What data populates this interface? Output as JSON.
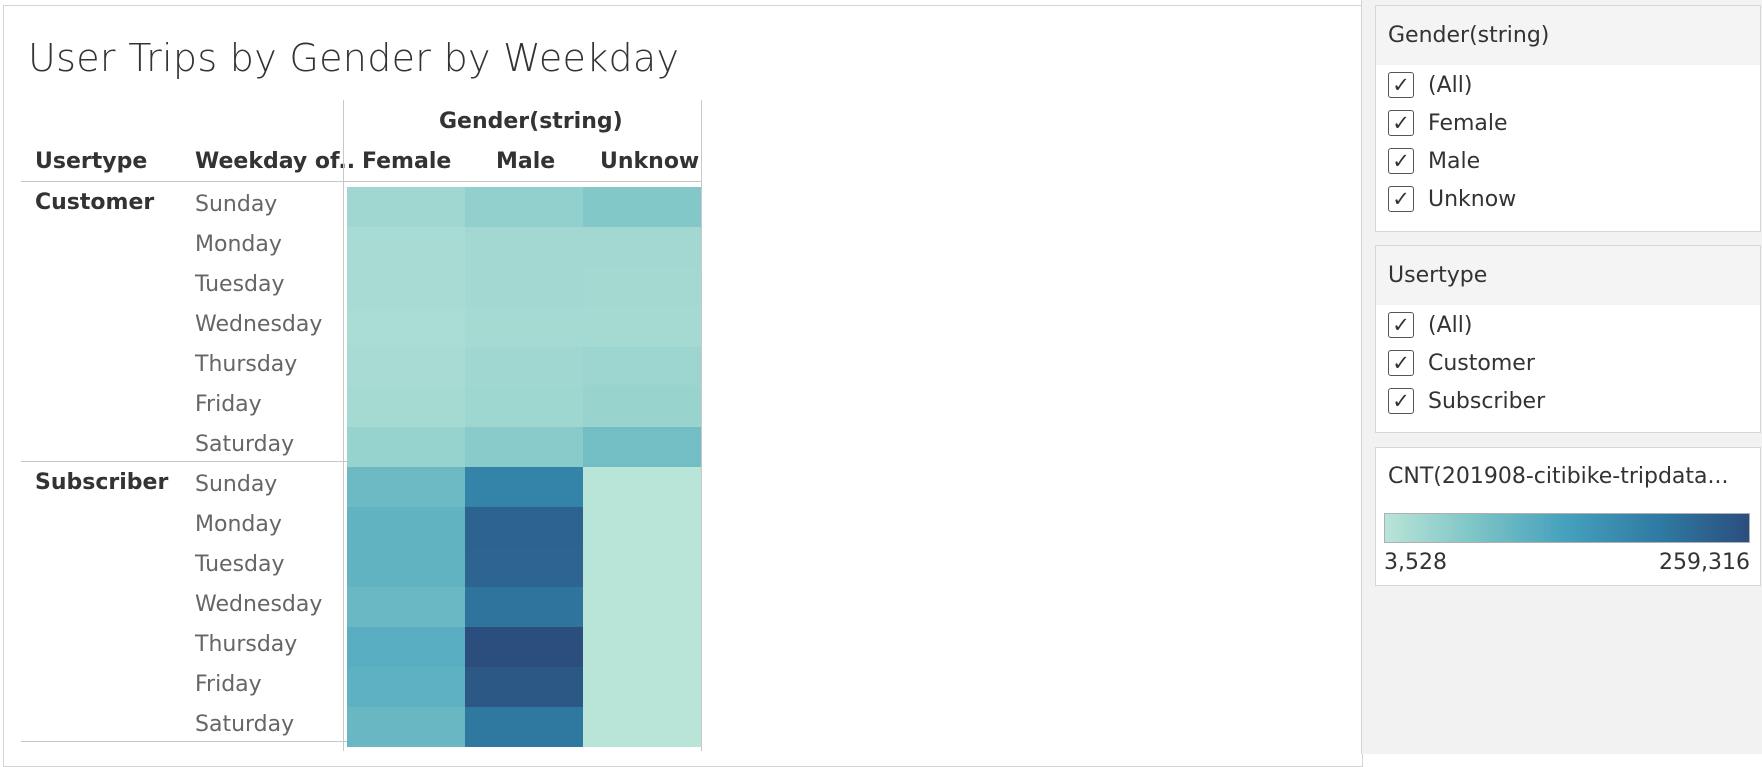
{
  "title": "User Trips by Gender by Weekday",
  "headers": {
    "usertype": "Usertype",
    "weekday": "Weekday of..",
    "gender_group": "Gender(string)"
  },
  "chart_data": {
    "type": "heatmap",
    "title": "User Trips by Gender by Weekday",
    "columns": [
      "Female",
      "Male",
      "Unknow"
    ],
    "row_groups": [
      "Customer",
      "Subscriber"
    ],
    "weekdays": [
      "Sunday",
      "Monday",
      "Tuesday",
      "Wednesday",
      "Thursday",
      "Friday",
      "Saturday"
    ],
    "values": {
      "Customer": [
        [
          30000,
          44000,
          60000
        ],
        [
          22000,
          28000,
          28000
        ],
        [
          22000,
          28000,
          26000
        ],
        [
          20000,
          24000,
          24000
        ],
        [
          22000,
          30000,
          34000
        ],
        [
          24000,
          32000,
          38000
        ],
        [
          40000,
          54000,
          78000
        ]
      ],
      "Subscriber": [
        [
          85000,
          180000,
          4000
        ],
        [
          98000,
          230000,
          3600
        ],
        [
          98000,
          228000,
          3600
        ],
        [
          88000,
          205000,
          3528
        ],
        [
          108000,
          259316,
          3800
        ],
        [
          102000,
          245000,
          3700
        ],
        [
          90000,
          200000,
          3700
        ]
      ]
    },
    "color_min": 3528,
    "color_max": 259316,
    "color_scale": [
      "#b9e4d8",
      "#7cc4c6",
      "#45a0bd",
      "#2f7ba3",
      "#2b4e7e"
    ]
  },
  "filters": {
    "gender": {
      "title": "Gender(string)",
      "options": [
        "(All)",
        "Female",
        "Male",
        "Unknow"
      ]
    },
    "usertype": {
      "title": "Usertype",
      "options": [
        "(All)",
        "Customer",
        "Subscriber"
      ]
    }
  },
  "legend": {
    "title": "CNT(201908-citibike-tripdata...",
    "min_label": "3,528",
    "max_label": "259,316"
  },
  "checkbox_glyph": "✓"
}
